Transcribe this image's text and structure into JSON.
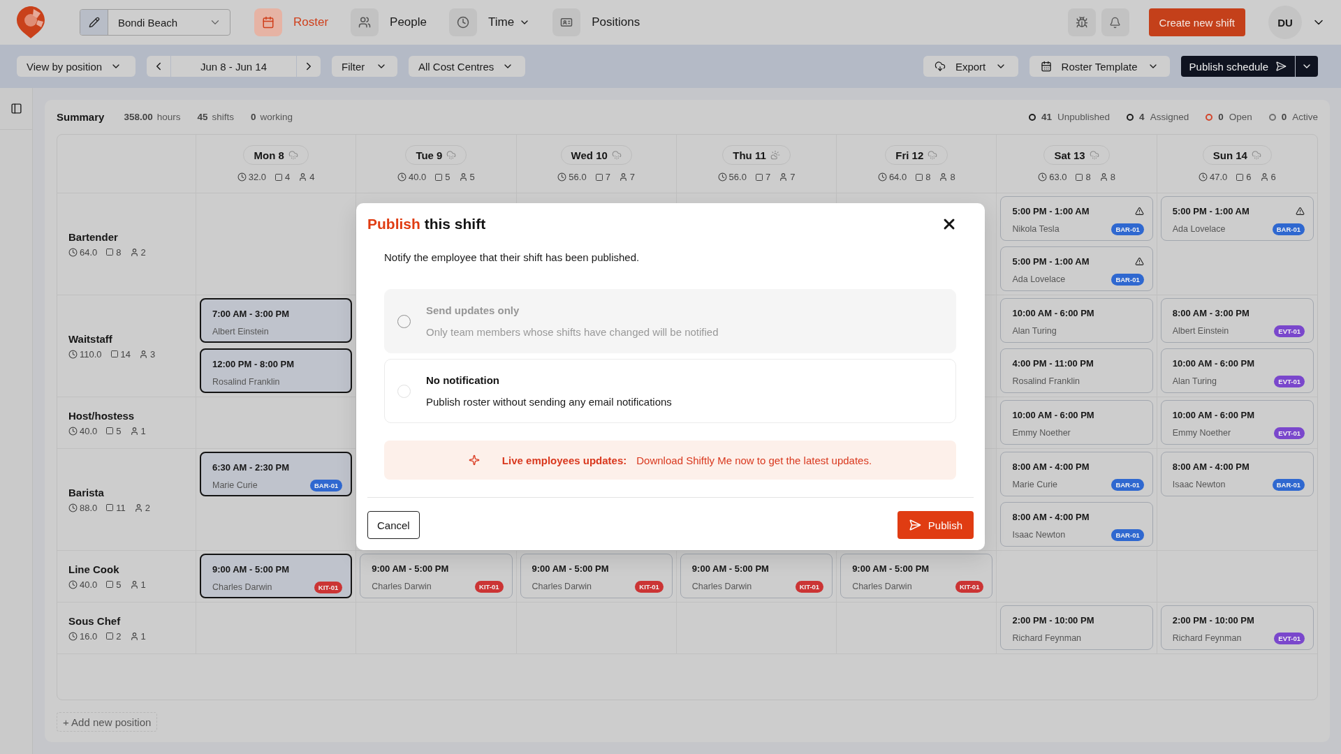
{
  "topbar": {
    "location": "Bondi Beach",
    "nav": [
      {
        "label": "Roster",
        "selected": true,
        "dropdown": false
      },
      {
        "label": "People",
        "selected": false,
        "dropdown": false
      },
      {
        "label": "Time",
        "selected": false,
        "dropdown": true
      },
      {
        "label": "Positions",
        "selected": false,
        "dropdown": false
      }
    ],
    "create_button": "Create new shift",
    "user_initials": "DU"
  },
  "toolbar": {
    "view": "View by position",
    "date_range": "Jun 8 - Jun 14",
    "filter": "Filter",
    "cost_centres": "All Cost Centres",
    "export": "Export",
    "template": "Roster Template",
    "publish": "Publish schedule"
  },
  "summary": {
    "title": "Summary",
    "stats": [
      {
        "value": "358.00",
        "unit": "hours"
      },
      {
        "value": "45",
        "unit": "shifts"
      },
      {
        "value": "0",
        "unit": "working"
      }
    ],
    "statuses": [
      {
        "count": "41",
        "label": "Unpublished",
        "color": "#1e1e1e"
      },
      {
        "count": "4",
        "label": "Assigned",
        "color": "#1e1e1e"
      },
      {
        "count": "0",
        "label": "Open",
        "color": "#d2452b"
      },
      {
        "count": "0",
        "label": "Active",
        "color": "#737373"
      }
    ]
  },
  "days": [
    {
      "label": "Mon 8",
      "kind": "rain",
      "hours": "32.0",
      "shifts": "4",
      "people": "4"
    },
    {
      "label": "Tue 9",
      "kind": "rain",
      "hours": "40.0",
      "shifts": "5",
      "people": "5"
    },
    {
      "label": "Wed 10",
      "kind": "rain",
      "hours": "56.0",
      "shifts": "7",
      "people": "7"
    },
    {
      "label": "Thu 11",
      "kind": "partly_cloudy",
      "hours": "56.0",
      "shifts": "7",
      "people": "7"
    },
    {
      "label": "Fri 12",
      "kind": "rain",
      "hours": "64.0",
      "shifts": "8",
      "people": "8"
    },
    {
      "label": "Sat 13",
      "kind": "rain",
      "hours": "63.0",
      "shifts": "8",
      "people": "8"
    },
    {
      "label": "Sun 14",
      "kind": "rain",
      "hours": "47.0",
      "shifts": "6",
      "people": "6"
    }
  ],
  "positions": [
    {
      "name": "Bartender",
      "hours": "64.0",
      "shifts": "8",
      "people": "2",
      "cells": [
        {},
        {},
        {},
        {},
        {},
        {
          "shifts": [
            {
              "time": "5:00 PM - 1:00 AM",
              "employee": "Nikola Tesla",
              "selected": false,
              "warning": true,
              "badge": {
                "label": "BAR-01",
                "color": "#2f68d0"
              }
            },
            {
              "time": "5:00 PM - 1:00 AM",
              "employee": "Ada Lovelace",
              "selected": false,
              "warning": true,
              "badge": {
                "label": "BAR-01",
                "color": "#2f68d0"
              }
            }
          ]
        },
        {
          "shifts": [
            {
              "time": "5:00 PM - 1:00 AM",
              "employee": "Ada Lovelace",
              "selected": false,
              "warning": true,
              "badge": {
                "label": "BAR-01",
                "color": "#2f68d0"
              }
            }
          ]
        }
      ]
    },
    {
      "name": "Waitstaff",
      "hours": "110.0",
      "shifts": "14",
      "people": "3",
      "cells": [
        {
          "shifts": [
            {
              "time": "7:00 AM - 3:00 PM",
              "employee": "Albert Einstein",
              "selected": true,
              "warning": false
            },
            {
              "time": "12:00 PM - 8:00 PM",
              "employee": "Rosalind Franklin",
              "selected": true,
              "warning": false
            }
          ]
        },
        {},
        {},
        {},
        {},
        {
          "shifts": [
            {
              "time": "10:00 AM - 6:00 PM",
              "employee": "Alan Turing",
              "selected": false,
              "warning": false
            },
            {
              "time": "4:00 PM - 11:00 PM",
              "employee": "Rosalind Franklin",
              "selected": false,
              "warning": false
            }
          ]
        },
        {
          "shifts": [
            {
              "time": "8:00 AM - 3:00 PM",
              "employee": "Albert Einstein",
              "selected": false,
              "warning": false,
              "badge": {
                "label": "EVT-01",
                "color": "#7a47cc"
              }
            },
            {
              "time": "10:00 AM - 6:00 PM",
              "employee": "Alan Turing",
              "selected": false,
              "warning": false,
              "badge": {
                "label": "EVT-01",
                "color": "#7a47cc"
              }
            }
          ]
        }
      ]
    },
    {
      "name": "Host/hostess",
      "hours": "40.0",
      "shifts": "5",
      "people": "1",
      "cells": [
        {},
        {},
        {},
        {},
        {},
        {
          "shifts": [
            {
              "time": "10:00 AM - 6:00 PM",
              "employee": "Emmy Noether",
              "selected": false,
              "warning": false
            }
          ]
        },
        {
          "shifts": [
            {
              "time": "10:00 AM - 6:00 PM",
              "employee": "Emmy Noether",
              "selected": false,
              "warning": false,
              "badge": {
                "label": "EVT-01",
                "color": "#7a47cc"
              }
            }
          ]
        }
      ]
    },
    {
      "name": "Barista",
      "hours": "88.0",
      "shifts": "11",
      "people": "2",
      "cells": [
        {
          "shifts": [
            {
              "time": "6:30 AM - 2:30 PM",
              "employee": "Marie Curie",
              "selected": true,
              "warning": false,
              "badge": {
                "label": "BAR-01",
                "color": "#2f68d0"
              }
            }
          ]
        },
        {},
        {},
        {},
        {},
        {
          "shifts": [
            {
              "time": "8:00 AM - 4:00 PM",
              "employee": "Marie Curie",
              "selected": false,
              "warning": false,
              "badge": {
                "label": "BAR-01",
                "color": "#2f68d0"
              }
            },
            {
              "time": "8:00 AM - 4:00 PM",
              "employee": "Isaac Newton",
              "selected": false,
              "warning": false,
              "badge": {
                "label": "BAR-01",
                "color": "#2f68d0"
              }
            }
          ]
        },
        {
          "shifts": [
            {
              "time": "8:00 AM - 4:00 PM",
              "employee": "Isaac Newton",
              "selected": false,
              "warning": false,
              "badge": {
                "label": "BAR-01",
                "color": "#2f68d0"
              }
            }
          ]
        }
      ]
    },
    {
      "name": "Line Cook",
      "hours": "40.0",
      "shifts": "5",
      "people": "1",
      "cells": [
        {
          "shifts": [
            {
              "time": "9:00 AM - 5:00 PM",
              "employee": "Charles Darwin",
              "selected": true,
              "warning": false,
              "badge": {
                "label": "KIT-01",
                "color": "#cb3434"
              }
            }
          ]
        },
        {
          "shifts": [
            {
              "time": "9:00 AM - 5:00 PM",
              "employee": "Charles Darwin",
              "selected": false,
              "warning": false,
              "badge": {
                "label": "KIT-01",
                "color": "#cb3434"
              }
            }
          ]
        },
        {
          "shifts": [
            {
              "time": "9:00 AM - 5:00 PM",
              "employee": "Charles Darwin",
              "selected": false,
              "warning": false,
              "badge": {
                "label": "KIT-01",
                "color": "#cb3434"
              }
            }
          ]
        },
        {
          "shifts": [
            {
              "time": "9:00 AM - 5:00 PM",
              "employee": "Charles Darwin",
              "selected": false,
              "warning": false,
              "badge": {
                "label": "KIT-01",
                "color": "#cb3434"
              }
            }
          ]
        },
        {
          "shifts": [
            {
              "time": "9:00 AM - 5:00 PM",
              "employee": "Charles Darwin",
              "selected": false,
              "warning": false,
              "badge": {
                "label": "KIT-01",
                "color": "#cb3434"
              }
            }
          ]
        },
        {},
        {}
      ]
    },
    {
      "name": "Sous Chef",
      "hours": "16.0",
      "shifts": "2",
      "people": "1",
      "cells": [
        {},
        {},
        {},
        {},
        {},
        {
          "shifts": [
            {
              "time": "2:00 PM - 10:00 PM",
              "employee": "Richard Feynman",
              "selected": false,
              "warning": false
            }
          ]
        },
        {
          "shifts": [
            {
              "time": "2:00 PM - 10:00 PM",
              "employee": "Richard Feynman",
              "selected": false,
              "warning": false,
              "badge": {
                "label": "EVT-01",
                "color": "#7a47cc"
              }
            }
          ]
        }
      ]
    }
  ],
  "add_position": "+ Add new position",
  "modal": {
    "title_accent": "Publish",
    "title": "this shift",
    "description": "Notify the employee that their shift has been published.",
    "options": [
      {
        "title": "Send updates only",
        "description": "Only team members whose shifts have changed will be notified",
        "selected": false,
        "disabled": true
      },
      {
        "title": "No notification",
        "description": "Publish roster without sending any email notifications",
        "selected": false,
        "disabled": false
      }
    ],
    "banner": {
      "label": "Live employees updates:",
      "message": "Download Shiftly Me now to get the latest updates."
    },
    "cancel": "Cancel",
    "confirm": "Publish"
  }
}
